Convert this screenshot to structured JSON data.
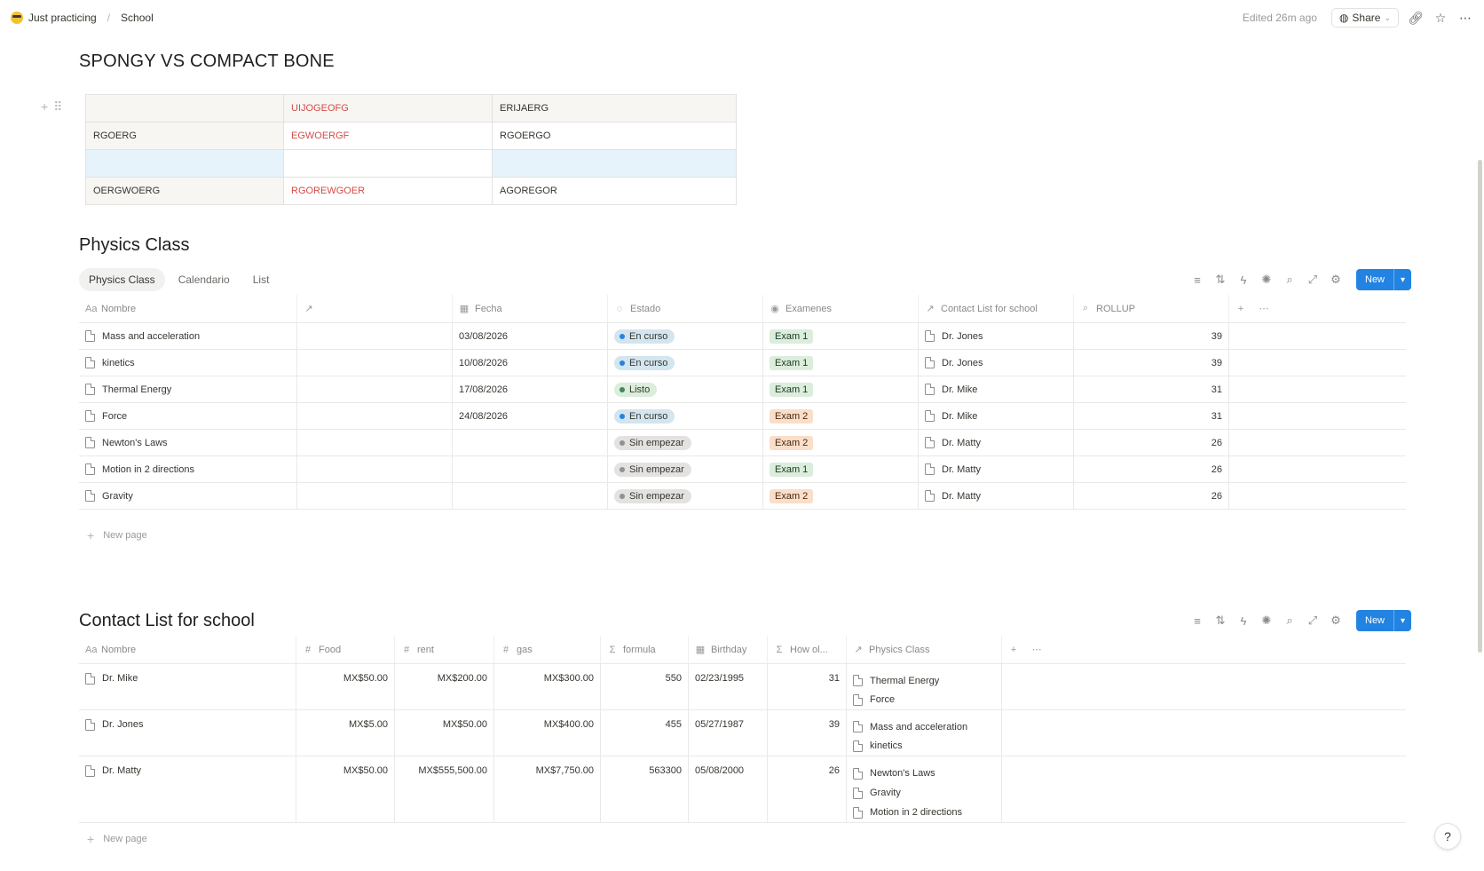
{
  "breadcrumb": {
    "workspace": "Just practicing",
    "page": "School"
  },
  "topbar": {
    "edited": "Edited 26m ago",
    "share": "Share"
  },
  "page": {
    "title": "SPONGY VS COMPACT BONE"
  },
  "simple_table": {
    "rows": [
      [
        "",
        "UIJOGEOFG",
        "ERIJAERG"
      ],
      [
        "RGOERG",
        "EGWOERGF",
        "RGOERGO"
      ],
      [
        "",
        "",
        ""
      ],
      [
        "OERGWOERG",
        "RGOREWGOER",
        "AGOREGOR"
      ]
    ]
  },
  "physics": {
    "title": "Physics Class",
    "tabs": [
      "Physics Class",
      "Calendario",
      "List"
    ],
    "new_label": "New",
    "columns": [
      "Nombre",
      "",
      "Fecha",
      "Estado",
      "Examenes",
      "Contact List for school",
      "ROLLUP"
    ],
    "rows": [
      {
        "nombre": "Mass and acceleration",
        "fecha": "03/08/2026",
        "estado": "En curso",
        "examen": "Exam 1",
        "contact": "Dr. Jones",
        "rollup": "39"
      },
      {
        "nombre": "kinetics",
        "fecha": "10/08/2026",
        "estado": "En curso",
        "examen": "Exam 1",
        "contact": "Dr. Jones",
        "rollup": "39"
      },
      {
        "nombre": "Thermal Energy",
        "fecha": "17/08/2026",
        "estado": "Listo",
        "examen": "Exam 1",
        "contact": "Dr. Mike",
        "rollup": "31"
      },
      {
        "nombre": "Force",
        "fecha": "24/08/2026",
        "estado": "En curso",
        "examen": "Exam 2",
        "contact": "Dr. Mike",
        "rollup": "31"
      },
      {
        "nombre": "Newton's Laws",
        "fecha": "",
        "estado": "Sin empezar",
        "examen": "Exam 2",
        "contact": "Dr. Matty",
        "rollup": "26"
      },
      {
        "nombre": "Motion in 2 directions",
        "fecha": "",
        "estado": "Sin empezar",
        "examen": "Exam 1",
        "contact": "Dr. Matty",
        "rollup": "26"
      },
      {
        "nombre": "Gravity",
        "fecha": "",
        "estado": "Sin empezar",
        "examen": "Exam 2",
        "contact": "Dr. Matty",
        "rollup": "26"
      }
    ],
    "new_page": "New page"
  },
  "contacts": {
    "title": "Contact List for school",
    "new_label": "New",
    "columns": [
      "Nombre",
      "Food",
      "rent",
      "gas",
      "formula",
      "Birthday",
      "How ol...",
      "Physics Class"
    ],
    "rows": [
      {
        "nombre": "Dr. Mike",
        "food": "MX$50.00",
        "rent": "MX$200.00",
        "gas": "MX$300.00",
        "formula": "550",
        "birthday": "02/23/1995",
        "age": "31",
        "classes": [
          "Thermal Energy",
          "Force"
        ]
      },
      {
        "nombre": "Dr. Jones",
        "food": "MX$5.00",
        "rent": "MX$50.00",
        "gas": "MX$400.00",
        "formula": "455",
        "birthday": "05/27/1987",
        "age": "39",
        "classes": [
          "Mass and acceleration",
          "kinetics"
        ]
      },
      {
        "nombre": "Dr. Matty",
        "food": "MX$50.00",
        "rent": "MX$555,500.00",
        "gas": "MX$7,750.00",
        "formula": "563300",
        "birthday": "05/08/2000",
        "age": "26",
        "classes": [
          "Newton's Laws",
          "Gravity",
          "Motion in 2 directions"
        ]
      }
    ],
    "new_page": "New page"
  },
  "colors": {
    "accent": "#2383e2",
    "status_en_curso_bg": "#d3e5ef",
    "status_en_curso_dot": "#2383e2",
    "status_listo_bg": "#dbeddb",
    "status_listo_dot": "#448361",
    "status_sin_empezar_bg": "#e3e2e0",
    "status_sin_empezar_dot": "#91918e",
    "exam1_bg": "#dbeddb",
    "exam1_fg": "#1c3829",
    "exam2_bg": "#fadec9",
    "exam2_fg": "#49290e",
    "red_text": "#d44c47"
  }
}
